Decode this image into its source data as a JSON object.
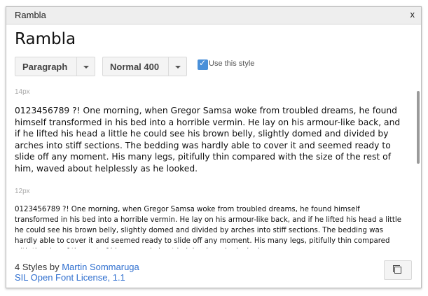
{
  "window": {
    "title": "Rambla",
    "close_label": "x"
  },
  "font": {
    "name": "Rambla"
  },
  "controls": {
    "block_type": "Paragraph",
    "weight": "Normal 400",
    "use_style_label": "Use this style",
    "use_style_checked": true
  },
  "samples": [
    {
      "size_label": "14px",
      "text": "0123456789 ?! One morning, when Gregor Samsa woke from troubled dreams, he found himself transformed in his bed into a horrible vermin. He lay on his armour-like back, and if he lifted his head a little he could see his brown belly, slightly domed and divided by arches into stiff sections. The bedding was hardly able to cover it and seemed ready to slide off any moment. His many legs, pitifully thin compared with the size of the rest of him, waved about helplessly as he looked."
    },
    {
      "size_label": "12px",
      "text": "0123456789 ?! One morning, when Gregor Samsa woke from troubled dreams, he found himself transformed in his bed into a horrible vermin. He lay on his armour-like back, and if he lifted his head a little he could see his brown belly, slightly domed and divided by arches into stiff sections. The bedding was hardly able to cover it and seemed ready to slide off any moment. His many legs, pitifully thin compared with the size of the rest of him, waved about helplessly as he looked."
    }
  ],
  "footer": {
    "styles_prefix": "4 Styles by",
    "author": "Martin Sommaruga",
    "license": "SIL Open Font License, 1.1"
  },
  "colors": {
    "link": "#2f6fcf",
    "checkbox": "#4a90d9"
  },
  "icons": {
    "collapse": "collapse-icon"
  }
}
